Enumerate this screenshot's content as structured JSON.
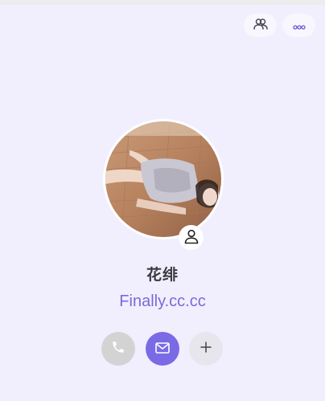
{
  "header": {
    "group_icon": "group-icon",
    "more_icon": "more-dots-icon"
  },
  "profile": {
    "name": "花绯",
    "subtitle": "Finally.cc.cc",
    "badge_icon": "person-icon"
  },
  "actions": {
    "call_icon": "phone-icon",
    "mail_icon": "mail-icon",
    "add_icon": "plus-icon"
  },
  "colors": {
    "background": "#f1effe",
    "accent": "#7b6ae6",
    "subtitle": "#7a6ad8",
    "name": "#3a3a3e"
  }
}
